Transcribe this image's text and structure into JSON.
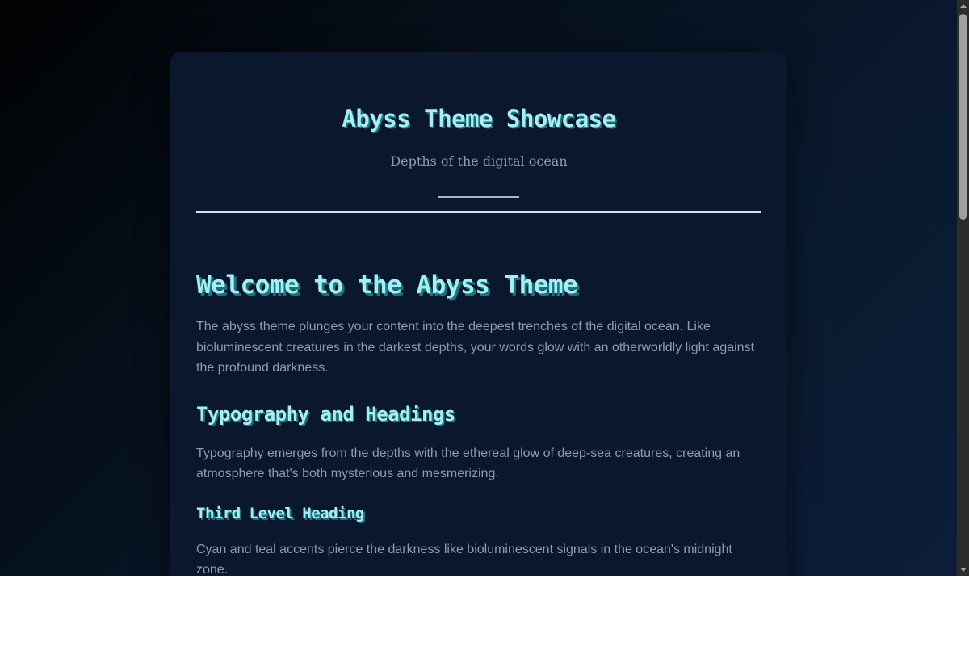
{
  "header": {
    "title": "Abyss Theme Showcase",
    "subtitle": "Depths of the digital ocean"
  },
  "content": {
    "h1": "Welcome to the Abyss Theme",
    "p1": "The abyss theme plunges your content into the deepest trenches of the digital ocean. Like bioluminescent creatures in the darkest depths, your words glow with an otherworldly light against the profound darkness.",
    "h2": "Typography and Headings",
    "p2": "Typography emerges from the depths with the ethereal glow of deep-sea creatures, creating an atmosphere that's both mysterious and mesmerizing.",
    "h3": "Third Level Heading",
    "p3": "Cyan and teal accents pierce the darkness like bioluminescent signals in the ocean's midnight zone."
  },
  "colors": {
    "background": "#0a172d",
    "heading": "#a9ecf3",
    "heading_shadow": "#11787e",
    "body_text": "#8d9bb5",
    "rule": "#d7def5"
  }
}
